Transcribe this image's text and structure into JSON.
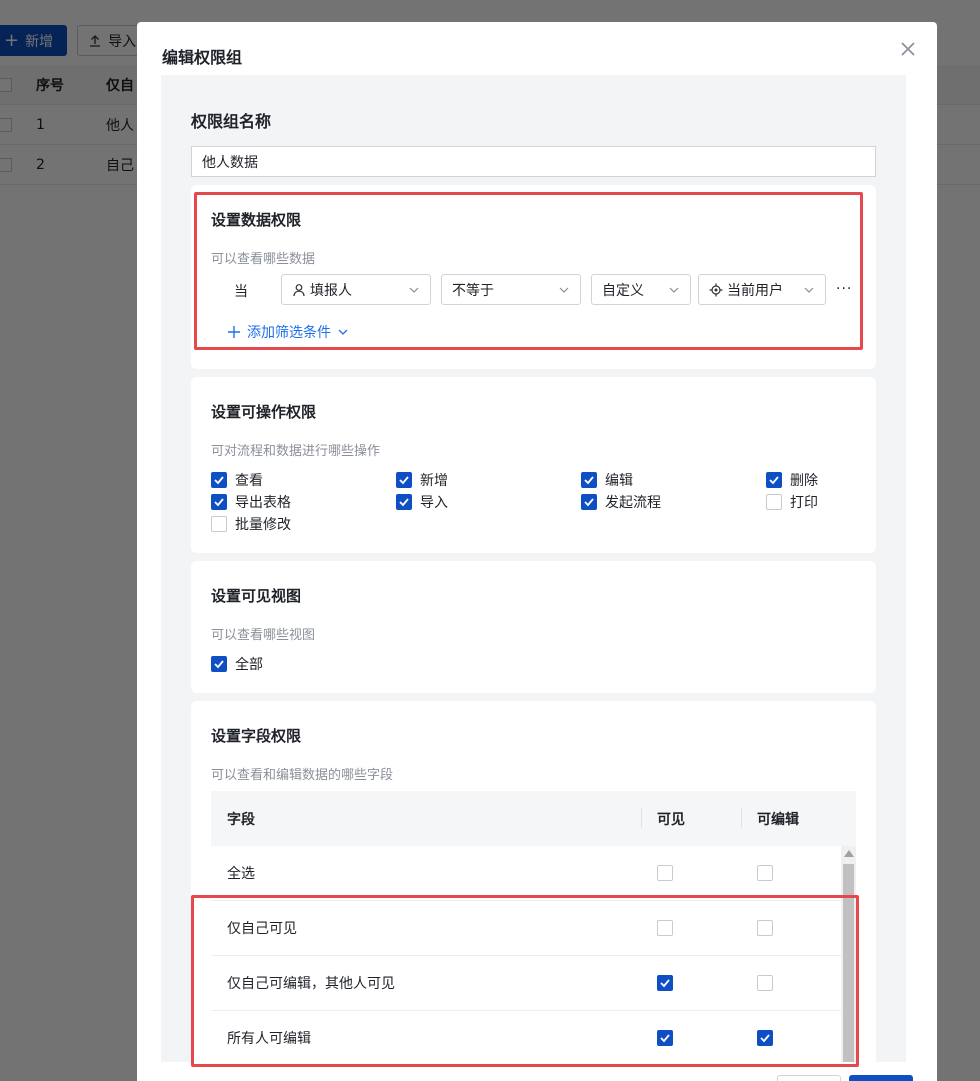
{
  "background": {
    "add_button": "新增",
    "import_button": "导入",
    "table": {
      "headers": [
        "序号",
        "仅自"
      ],
      "rows": [
        {
          "no": "1",
          "name": "他人"
        },
        {
          "no": "2",
          "name": "自己"
        }
      ]
    }
  },
  "modal": {
    "title": "编辑权限组",
    "group_name": {
      "label": "权限组名称",
      "value": "他人数据"
    },
    "data_permission": {
      "title": "设置数据权限",
      "subtitle": "可以查看哪些数据",
      "condition_prefix": "当",
      "field_select": "填报人",
      "operator_select": "不等于",
      "type_select": "自定义",
      "value_select": "当前用户",
      "more": "···",
      "add_filter": "添加筛选条件"
    },
    "operation_permission": {
      "title": "设置可操作权限",
      "subtitle": "可对流程和数据进行哪些操作",
      "options": [
        {
          "label": "查看",
          "checked": true
        },
        {
          "label": "新增",
          "checked": true
        },
        {
          "label": "编辑",
          "checked": true
        },
        {
          "label": "删除",
          "checked": true
        },
        {
          "label": "导出表格",
          "checked": true
        },
        {
          "label": "导入",
          "checked": true
        },
        {
          "label": "发起流程",
          "checked": true
        },
        {
          "label": "打印",
          "checked": false
        },
        {
          "label": "批量修改",
          "checked": false
        }
      ]
    },
    "view_permission": {
      "title": "设置可见视图",
      "subtitle": "可以查看哪些视图",
      "options": [
        {
          "label": "全部",
          "checked": true
        }
      ]
    },
    "field_permission": {
      "title": "设置字段权限",
      "subtitle": "可以查看和编辑数据的哪些字段",
      "headers": {
        "field": "字段",
        "visible": "可见",
        "editable": "可编辑"
      },
      "rows": [
        {
          "field": "全选",
          "visible": false,
          "editable": false
        },
        {
          "field": "仅自己可见",
          "visible": false,
          "editable": false
        },
        {
          "field": "仅自己可编辑，其他人可见",
          "visible": true,
          "editable": false
        },
        {
          "field": "所有人可编辑",
          "visible": true,
          "editable": true
        }
      ]
    }
  },
  "colors": {
    "primary": "#0f4fc4",
    "link": "#1f6feb",
    "highlight": "#e5484d"
  }
}
